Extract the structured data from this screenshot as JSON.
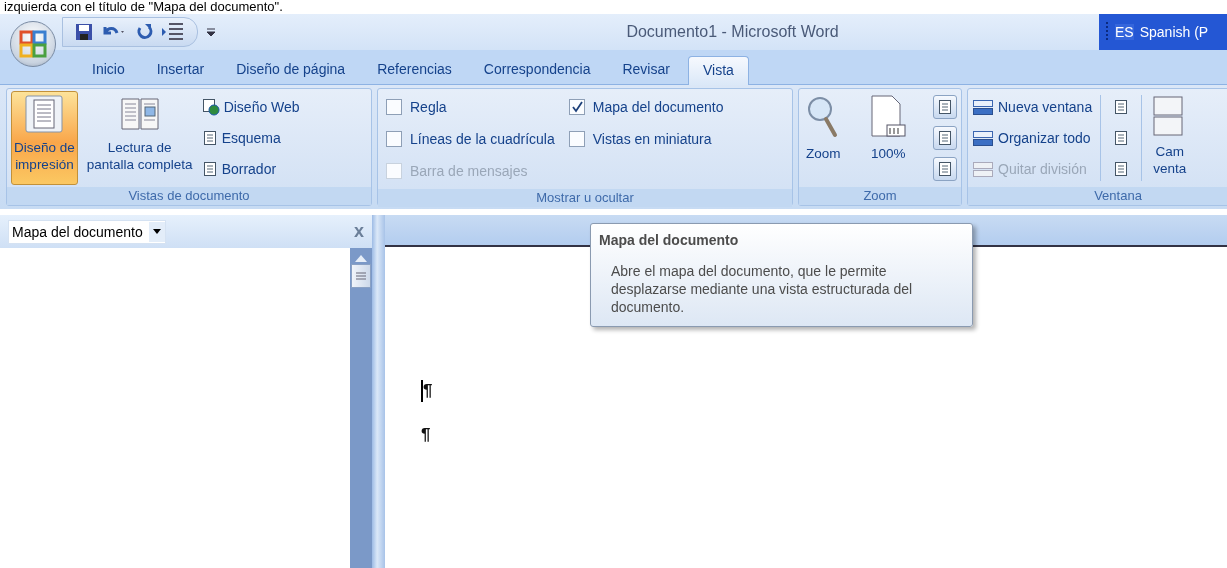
{
  "caption": "izquierda con el título de \"Mapa del documento\".",
  "title_bar": {
    "title": "Documento1 - Microsoft Word"
  },
  "language_bar": {
    "code": "ES",
    "label": "Spanish (P"
  },
  "tabs": [
    {
      "label": "Inicio",
      "selected": false
    },
    {
      "label": "Insertar",
      "selected": false
    },
    {
      "label": "Diseño de página",
      "selected": false
    },
    {
      "label": "Referencias",
      "selected": false
    },
    {
      "label": "Correspondencia",
      "selected": false
    },
    {
      "label": "Revisar",
      "selected": false
    },
    {
      "label": "Vista",
      "selected": true
    }
  ],
  "ribbon": [
    {
      "kind": "views",
      "title": "Vistas de documento",
      "large": [
        {
          "lines": [
            "Diseño de",
            "impresión"
          ],
          "selected": true
        },
        {
          "lines": [
            "Lectura de",
            "pantalla completa"
          ],
          "selected": false
        }
      ],
      "small": [
        {
          "label": "Diseño Web"
        },
        {
          "label": "Esquema"
        },
        {
          "label": "Borrador"
        }
      ]
    },
    {
      "kind": "show",
      "title": "Mostrar u ocultar",
      "checkboxes": [
        {
          "label": "Regla",
          "checked": false,
          "disabled": false
        },
        {
          "label": "Líneas de la cuadrícula",
          "checked": false,
          "disabled": false
        },
        {
          "label": "Barra de mensajes",
          "checked": false,
          "disabled": true
        },
        {
          "label": "Mapa del documento",
          "checked": true,
          "disabled": false
        },
        {
          "label": "Vistas en miniatura",
          "checked": false,
          "disabled": false
        }
      ]
    },
    {
      "kind": "zoom",
      "title": "Zoom",
      "large": [
        {
          "lines": [
            "Zoom"
          ]
        },
        {
          "lines": [
            "100%"
          ]
        }
      ]
    },
    {
      "kind": "window",
      "title": "Ventana",
      "small": [
        {
          "label": "Nueva ventana",
          "disabled": false
        },
        {
          "label": "Organizar todo",
          "disabled": false
        },
        {
          "label": "Quitar división",
          "disabled": true
        }
      ],
      "large": [
        {
          "lines": [
            "Cam",
            "venta"
          ]
        }
      ]
    }
  ],
  "document_map": {
    "selector": "Mapa del documento",
    "close": "x"
  },
  "document": {
    "paragraphs": [
      "¶",
      "¶"
    ]
  },
  "tooltip": {
    "title": "Mapa del documento",
    "body": "Abre el mapa del documento, que le permite desplazarse mediante una vista estructurada del documento."
  }
}
